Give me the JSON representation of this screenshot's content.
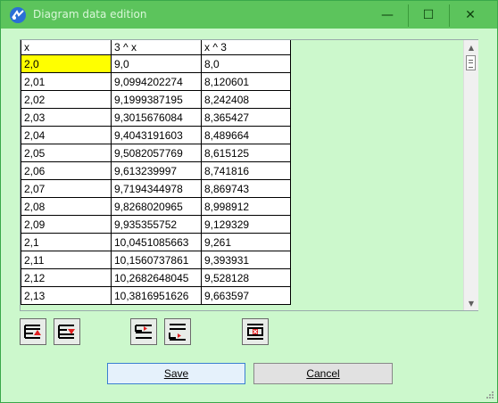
{
  "window": {
    "title": "Diagram data edition",
    "minimize_glyph": "—",
    "maximize_glyph": "☐",
    "close_glyph": "✕"
  },
  "grid": {
    "columns": [
      "x",
      "3 ^ x",
      "x ^ 3"
    ],
    "rows": [
      [
        "2,0",
        "9,0",
        "8,0"
      ],
      [
        "2,01",
        "9,0994202274",
        "8,120601"
      ],
      [
        "2,02",
        "9,1999387195",
        "8,242408"
      ],
      [
        "2,03",
        "9,3015676084",
        "8,365427"
      ],
      [
        "2,04",
        "9,4043191603",
        "8,489664"
      ],
      [
        "2,05",
        "9,5082057769",
        "8,615125"
      ],
      [
        "2,06",
        "9,613239997",
        "8,741816"
      ],
      [
        "2,07",
        "9,7194344978",
        "8,869743"
      ],
      [
        "2,08",
        "9,8268020965",
        "8,998912"
      ],
      [
        "2,09",
        "9,935355752",
        "9,129329"
      ],
      [
        "2,1",
        "10,0451085663",
        "9,261"
      ],
      [
        "2,11",
        "10,1560737861",
        "9,393931"
      ],
      [
        "2,12",
        "10,2682648045",
        "9,528128"
      ],
      [
        "2,13",
        "10,3816951626",
        "9,663597"
      ]
    ],
    "selected_cell": "2,0"
  },
  "toolbar": {
    "icons": [
      "insert-row-above-icon",
      "delete-row-icon",
      "insert-column-icon",
      "insert-column-after-icon",
      "delete-column-icon"
    ]
  },
  "buttons": {
    "save_label": "Save",
    "cancel_label": "Cancel"
  },
  "colors": {
    "background": "#CCF8CC",
    "titlebar": "#5CC45C",
    "selection": "#FFFF00",
    "accent_red": "#E02020"
  }
}
